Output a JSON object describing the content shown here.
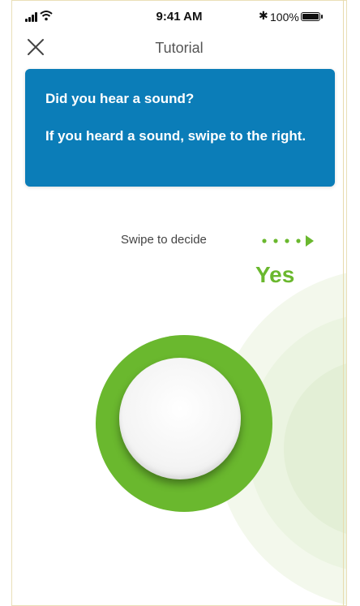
{
  "status_bar": {
    "time": "9:41 AM",
    "battery_percent": "100%",
    "icons": [
      "signal-icon",
      "wifi-icon",
      "bluetooth-icon",
      "battery-icon"
    ]
  },
  "nav": {
    "title": "Tutorial",
    "close_icon": "close-icon"
  },
  "card": {
    "question": "Did you hear a sound?",
    "instruction": "If you heard a sound, swipe to the right."
  },
  "swipe": {
    "hint": "Swipe to decide",
    "yes_label": "Yes",
    "arrow_icon": "swipe-right-arrow-icon"
  },
  "colors": {
    "card_blue": "#0b7db8",
    "accent_green": "#6ab82e",
    "ripple_light": "#f3f8ec"
  }
}
